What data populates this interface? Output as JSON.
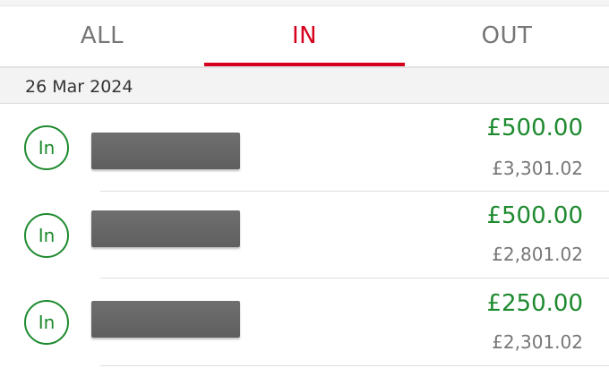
{
  "tabs": [
    {
      "label": "ALL",
      "active": false
    },
    {
      "label": "IN",
      "active": true
    },
    {
      "label": "OUT",
      "active": false
    }
  ],
  "date_header": "26 Mar 2024",
  "transactions": [
    {
      "badge": "In",
      "amount": "£500.00",
      "balance": "£3,301.02"
    },
    {
      "badge": "In",
      "amount": "£500.00",
      "balance": "£2,801.02"
    },
    {
      "badge": "In",
      "amount": "£250.00",
      "balance": "£2,301.02"
    }
  ],
  "colors": {
    "accent_red": "#d6001c",
    "credit_green": "#1e8a2f",
    "muted_grey": "#767676",
    "redaction": "#666666"
  }
}
